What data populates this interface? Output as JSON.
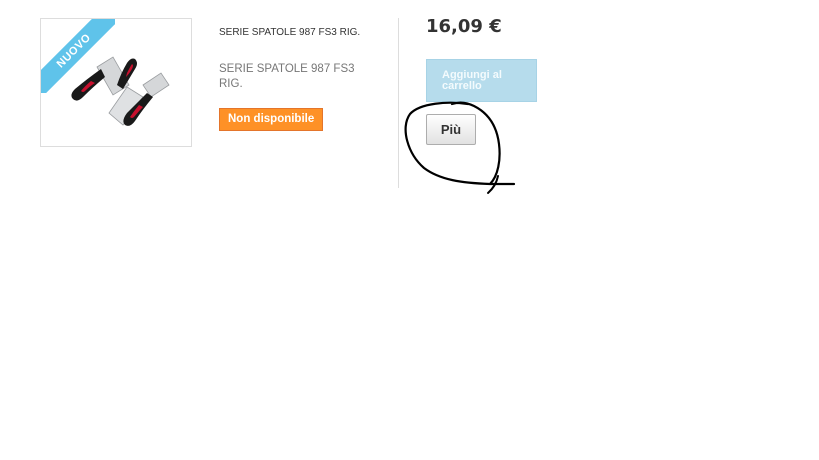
{
  "product": {
    "badge": "Nuovo",
    "name": "SERIE SPATOLE 987 FS3 RIG.",
    "description": "SERIE SPATOLE 987 FS3 RIG.",
    "availability": "Non disponibile",
    "price": "16,09 €",
    "add_to_cart_label": "Aggiungi al carrello",
    "more_label": "Più",
    "image_icon": "spatula-set-image"
  },
  "colors": {
    "badge": "#5fc3ea",
    "availability": "#fe9126",
    "add_to_cart_disabled": "#b6dcec",
    "annotation_stroke": "#000000"
  }
}
